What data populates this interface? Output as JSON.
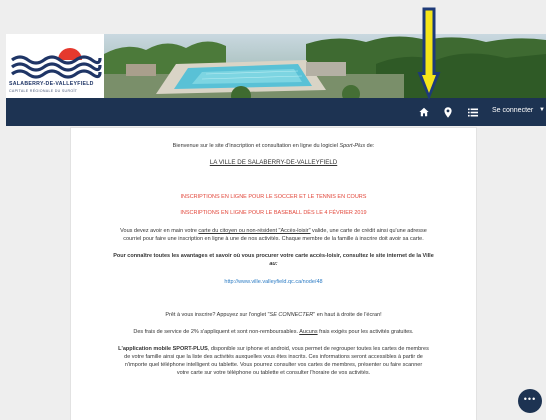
{
  "logo": {
    "line1": "SALABERRY-DE-VALLEYFIELD",
    "line2": "CAPITALE RÉGIONALE DU SUROÎT"
  },
  "navbar": {
    "login_label": "Se connecter",
    "icons": [
      "home-icon",
      "map-marker-icon",
      "list-icon",
      "caret-down-icon"
    ]
  },
  "content": {
    "welcome_prefix": "Bienvenue sur le site d'inscription et consultation en ligne du logiciel ",
    "welcome_software": "Sport-Plus",
    "welcome_suffix": " de:",
    "city_name": "LA VILLE DE SALABERRY-DE-VALLEYFIELD",
    "notice_soccer": "INSCRIPTIONS EN LIGNE POUR LE SOCCER ET LE TENNIS EN COURS",
    "notice_baseball": "INSCRIPTIONS EN LIGNE POUR LE BASEBALL DÈS LE 4 FÉVRIER 2019",
    "card_p1a": "Vous devez avoir en main votre ",
    "card_p1_link": "carte du citoyen ou non-résident \"Accès-loisir\"",
    "card_p1b": " valide, une carte de crédit ainsi qu'une adresse",
    "card_p1_line2": "courriel pour faire une inscription en ligne à une de nos activités. Chaque membre de la famille à inscrire doit avoir sa carte.",
    "advantages_line1": "Pour connaître toutes les avantages et savoir où vous procurer votre carte accès-loisir, consultez le site internet de la Ville",
    "advantages_line2": "au:",
    "city_url": "http://www.ville.valleyfield.qc.ca/node/48",
    "ready_prefix": "Prêt à vous inscrire? Appuyez sur l'onglet \"",
    "ready_tab": "SE CONNECTER",
    "ready_suffix": "\" en haut à droite de l'écran!",
    "fees_prefix": "Des frais de service de 2% s'appliquent et sont non-remboursables. ",
    "fees_underlined": "Aucuns",
    "fees_suffix": " frais exigés pour les activités gratuites.",
    "app_bold": "L'application mobile SPORT-PLUS",
    "app_line1": ", disponible sur iphone et android, vous permet de regrouper toutes les cartes de membres",
    "app_line2": "de votre famille ainsi que la liste des activités auxquelles vous êtes inscrits. Ces informations seront accessibles à partir de",
    "app_line3": "n'importe quel téléphone intelligent ou tablette. Vous pourrez consulter vos cartes de membres, présenter ou faire scanner",
    "app_line4": "votre carte sur votre téléphone ou tablette et consulter l'horaire de vos activités."
  },
  "fab": {
    "label": "•••"
  },
  "colors": {
    "navbar": "#1d3352",
    "accent_red": "#e2463a",
    "link_blue": "#2b7bc4",
    "arrow_yellow": "#f5e51a"
  }
}
